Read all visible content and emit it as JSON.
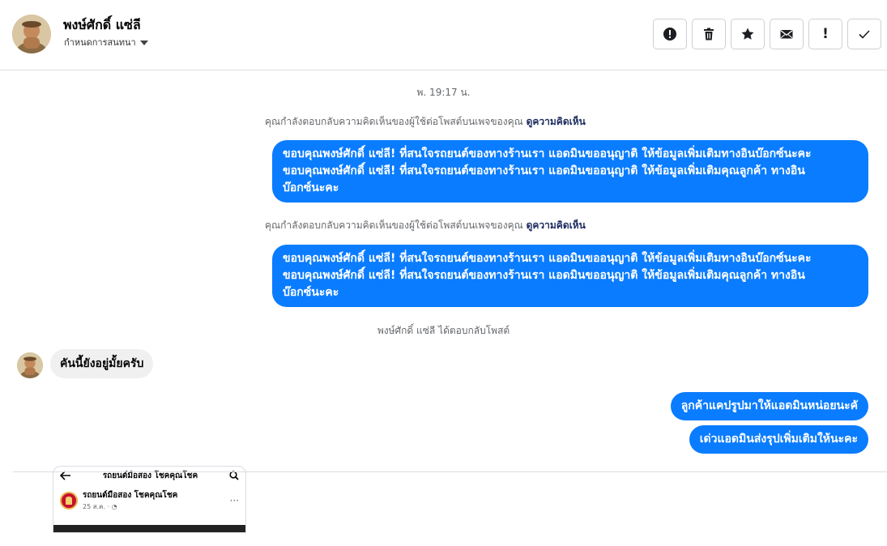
{
  "header": {
    "contact_name": "พงษ์ศักดิ์ แซ่ลี",
    "conversation_label": "กำหนดการสนทนา",
    "toolbar": [
      {
        "name": "report-spam-button",
        "icon": "exclamation-circle-icon"
      },
      {
        "name": "delete-button",
        "icon": "trash-icon"
      },
      {
        "name": "star-button",
        "icon": "star-icon"
      },
      {
        "name": "mark-unread-button",
        "icon": "envelope-icon"
      },
      {
        "name": "important-button",
        "icon": "exclamation-icon",
        "glyph": "!"
      },
      {
        "name": "done-button",
        "icon": "checkmark-icon"
      }
    ]
  },
  "thread": {
    "timestamp": "พ. 19:17 น.",
    "reply_notes": [
      {
        "text": "คุณกำลังตอบกลับความคิดเห็นของผู้ใช้ต่อโพสต์บนเพจของคุณ",
        "link": "ดูความคิดเห็น"
      },
      {
        "text": "คุณกำลังตอบกลับความคิดเห็นของผู้ใช้ต่อโพสต์บนเพจของคุณ",
        "link": "ดูความคิดเห็น"
      }
    ],
    "outgoing_long": [
      {
        "line1": "ขอบคุณพงษ์ศักดิ์ แซ่ลี! ที่สนใจรถยนต์ของทางร้านเรา แอดมินขออนุญาติ ให้ข้อมูลเพิ่มเติมทางอินบ๊อกซ์นะคะ",
        "line2": "ขอบคุณพงษ์ศักดิ์ แซ่ลี! ที่สนใจรถยนต์ของทางร้านเรา แอดมินขออนุญาติ ให้ข้อมูลเพิ่มเติมคุณลูกค้า ทางอิน",
        "line3": "บ๊อกซ์นะคะ"
      },
      {
        "line1": "ขอบคุณพงษ์ศักดิ์ แซ่ลี! ที่สนใจรถยนต์ของทางร้านเรา แอดมินขออนุญาติ ให้ข้อมูลเพิ่มเติมทางอินบ๊อกซ์นะคะ",
        "line2": "ขอบคุณพงษ์ศักดิ์ แซ่ลี! ที่สนใจรถยนต์ของทางร้านเรา แอดมินขออนุญาติ ให้ข้อมูลเพิ่มเติมคุณลูกค้า ทางอิน",
        "line3": "บ๊อกซ์นะคะ"
      }
    ],
    "system_note": "พงษ์ศักดิ์ แซ่ลี ได้ตอบกลับโพสต์",
    "incoming_message": "คันนี้ยังอยู่มั้ยครับ",
    "outgoing_short": [
      "ลูกค้าแคปรูปมาให้แอดมินหน่อยนะคั",
      "เด่วแอดมินส่งรุปเพิ่มเติมให้นะคะ"
    ],
    "attachment": {
      "title": "รถยนต์มือสอง โชคคุณโชค",
      "page_name": "รถยนต์มือสอง โชคคุณโชค",
      "date": "25 ส.ค. · ",
      "more": "···"
    }
  },
  "colors": {
    "outgoing_bubble": "#0a7cff",
    "incoming_bubble": "#f0f0f0",
    "muted_text": "#65676b",
    "link_text": "#1c2b5e"
  }
}
